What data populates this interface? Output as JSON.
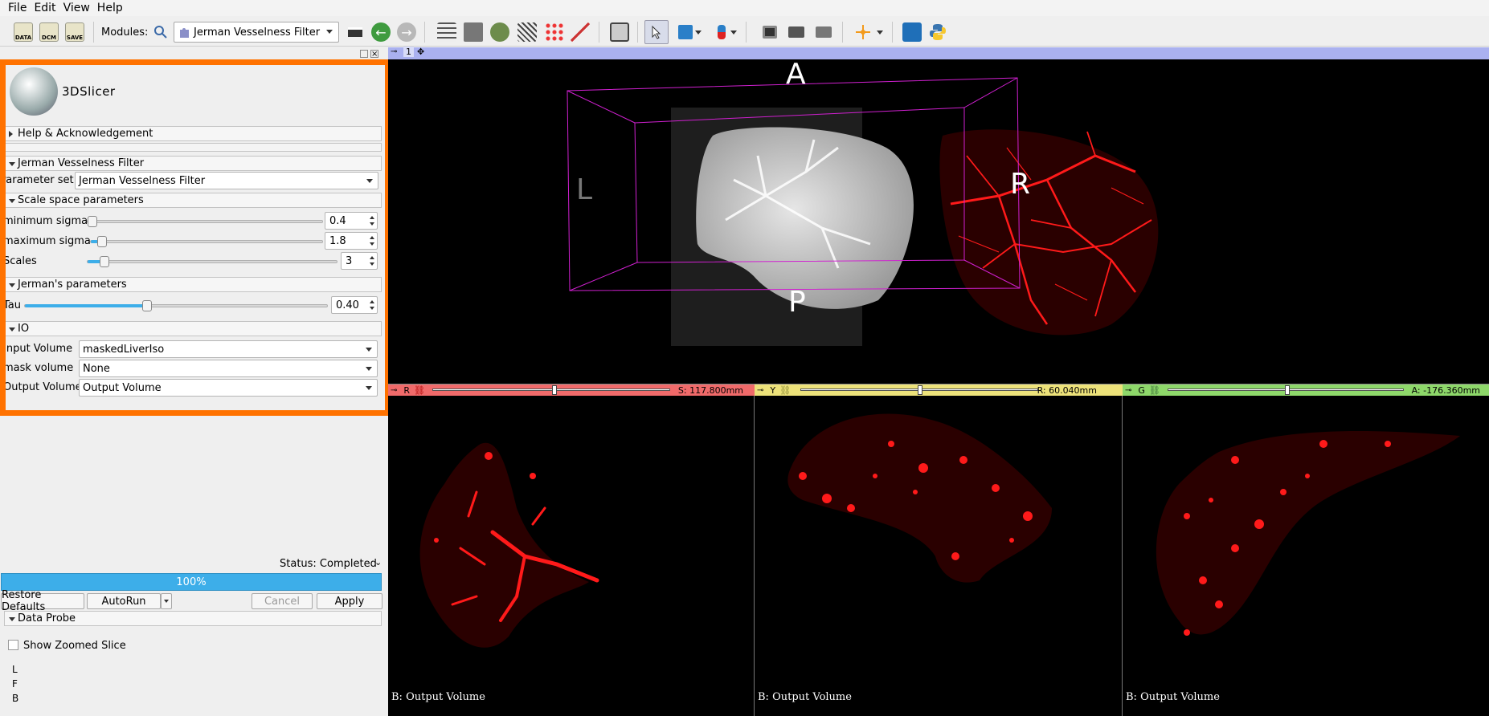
{
  "menu": {
    "file": "File",
    "edit": "Edit",
    "view": "View",
    "help": "Help"
  },
  "toolbar": {
    "data_label": "DATA",
    "dcm_label": "DCM",
    "save_label": "SAVE",
    "modules_label": "Modules:",
    "module_selected": "Jerman Vesselness Filter"
  },
  "logo": {
    "text": "3DSlicer"
  },
  "sections": {
    "help": "Help & Acknowledgement",
    "module": "Jerman Vesselness Filter",
    "scale": "Scale space parameters",
    "jerman": "Jerman's parameters",
    "io": "IO",
    "probe": "Data Probe"
  },
  "params": {
    "parameter_set_label": "Parameter set:",
    "parameter_set_value": "Jerman Vesselness Filter",
    "min_sigma_label": "minimum sigma",
    "min_sigma_value": "0.4",
    "min_sigma_level": 0.0,
    "max_sigma_label": "maximum sigma",
    "max_sigma_value": "1.8",
    "max_sigma_level": 0.03,
    "scales_label": "Scales",
    "scales_value": "3",
    "scales_level": 0.05,
    "tau_label": "Tau",
    "tau_value": "0.40",
    "tau_level": 0.4
  },
  "io": {
    "input_label": "Input Volume",
    "input_value": "maskedLiverIso",
    "mask_label": "mask volume",
    "mask_value": "None",
    "output_label": "Output Volume",
    "output_value": "Output Volume"
  },
  "status": {
    "text": "Status: Completed",
    "progress": "100%",
    "progress_level": 1.0
  },
  "buttons": {
    "restore": "Restore Defaults",
    "autorun": "AutoRun",
    "cancel": "Cancel",
    "apply": "Apply"
  },
  "probe": {
    "zoom_label": "Show Zoomed Slice",
    "l": "L",
    "f": "F",
    "b": "B"
  },
  "view3d": {
    "tab": "1",
    "A": "A",
    "P": "P",
    "L": "L",
    "R": "R"
  },
  "slices": {
    "red": {
      "letter": "R",
      "offset": "S: 117.800mm",
      "label": "B: Output Volume",
      "color": "#f06a6a"
    },
    "yellow": {
      "letter": "Y",
      "offset": "R: 60.040mm",
      "label": "B: Output Volume",
      "color": "#ede27a"
    },
    "green": {
      "letter": "G",
      "offset": "A: -176.360mm",
      "label": "B: Output Volume",
      "color": "#8ed86a"
    }
  }
}
